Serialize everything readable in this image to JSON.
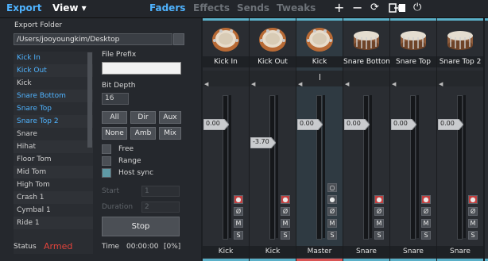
{
  "topbar": {
    "export_label": "Export",
    "view_label": "View ▾",
    "tabs": [
      "Faders",
      "Effects",
      "Sends",
      "Tweaks"
    ],
    "active_tab": "Faders",
    "icons": [
      "plus-icon",
      "minus-icon",
      "refresh-icon",
      "route-icon",
      "power-icon"
    ]
  },
  "export": {
    "folder_label": "Export Folder",
    "folder_path": "/Users/jooyoungkim/Desktop",
    "tracks": [
      {
        "label": "Kick In",
        "selected": true
      },
      {
        "label": "Kick Out",
        "selected": true
      },
      {
        "label": "Kick",
        "selected": false
      },
      {
        "label": "Snare Bottom",
        "selected": true
      },
      {
        "label": "Snare Top",
        "selected": true
      },
      {
        "label": "Snare Top 2",
        "selected": true
      },
      {
        "label": "Snare",
        "selected": false
      },
      {
        "label": "Hihat",
        "selected": false
      },
      {
        "label": "Floor Tom",
        "selected": false
      },
      {
        "label": "Mid Tom",
        "selected": false
      },
      {
        "label": "High Tom",
        "selected": false
      },
      {
        "label": "Crash 1",
        "selected": false
      },
      {
        "label": "Cymbal 1",
        "selected": false
      },
      {
        "label": "Ride 1",
        "selected": false
      }
    ],
    "file_prefix_label": "File Prefix",
    "file_prefix_value": "",
    "bit_depth_label": "Bit Depth",
    "bit_depth_value": "16",
    "filter_buttons": [
      "All",
      "Dir",
      "Aux",
      "None",
      "Amb",
      "Mix"
    ],
    "checkboxes": [
      {
        "label": "Free",
        "checked": false
      },
      {
        "label": "Range",
        "checked": false
      },
      {
        "label": "Host sync",
        "checked": true
      }
    ],
    "start_label": "Start",
    "start_value": "1",
    "duration_label": "Duration",
    "duration_value": "2",
    "stop_label": "Stop",
    "status_label": "Status",
    "status_value": "Armed",
    "time_label": "Time",
    "time_value": "00:00:00",
    "percent_value": "[0%]"
  },
  "mixer": {
    "strips": [
      {
        "name": "Kick In",
        "instrument": "kick",
        "fader_value": "0.00",
        "fader_level": 0.8,
        "output": "Kick",
        "master": false
      },
      {
        "name": "Kick Out",
        "instrument": "kick",
        "fader_value": "-3.70",
        "fader_level": 0.67,
        "output": "Kick",
        "master": false
      },
      {
        "name": "Kick",
        "instrument": "kick",
        "fader_value": "0.00",
        "fader_level": 0.8,
        "output": "Master",
        "master": true
      },
      {
        "name": "Snare Bottom",
        "instrument": "snare",
        "fader_value": "0.00",
        "fader_level": 0.8,
        "output": "Snare",
        "master": false
      },
      {
        "name": "Snare Top",
        "instrument": "snare",
        "fader_value": "0.00",
        "fader_level": 0.8,
        "output": "Snare",
        "master": false
      },
      {
        "name": "Snare Top 2",
        "instrument": "snare",
        "fader_value": "0.00",
        "fader_level": 0.8,
        "output": "Snare",
        "master": false
      }
    ]
  },
  "colors": {
    "accent": "#4fb3ff",
    "armed": "#e2433b",
    "strip_line": "#5ab0c8",
    "master_line": "#d95555"
  }
}
